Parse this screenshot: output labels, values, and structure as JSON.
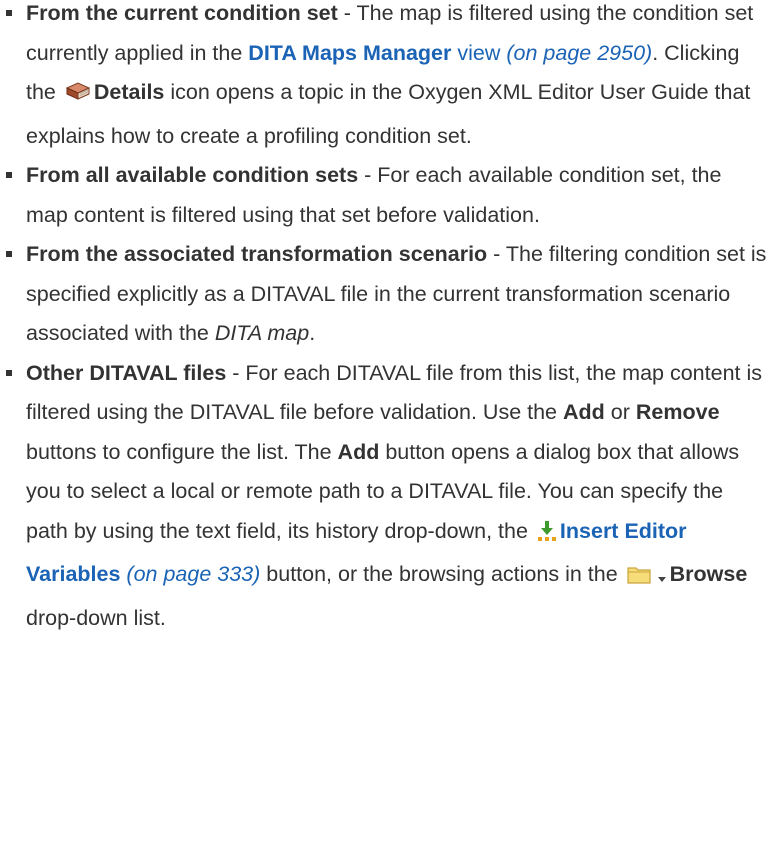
{
  "items": [
    {
      "title": "From the current condition set",
      "sep": " - ",
      "t1": "The map is filtered using the condition set currently applied in the ",
      "link_bold": "DITA Maps Manager",
      "link_tail": " view",
      "pageref": "(on page 2950)",
      "t2": ". Clicking the ",
      "icon": "book-icon",
      "details": "Details",
      "t3": " icon opens a topic in the Oxygen XML Editor User Guide that explains how to create a profiling condition set."
    },
    {
      "title": "From all available condition sets",
      "sep": " - ",
      "t1": "For each available condition set, the map content is filtered using that set before validation."
    },
    {
      "title": "From the associated transformation scenario",
      "sep": " - ",
      "t1": "The filtering condition set is specified explicitly as a DITAVAL file in the current transformation scenario associated with the ",
      "em": "DITA map",
      "t2": "."
    },
    {
      "title": "Other DITAVAL files",
      "sep": " - ",
      "t1": "For each DITAVAL file from this list, the map content is filtered using the DITAVAL file before validation. Use the ",
      "add": "Add",
      "or": " or ",
      "remove": "Remove",
      "t2": " buttons to configure the list. The ",
      "add2": "Add",
      "t3": " button opens a dialog box that allows you to select a local or remote path to a DITAVAL file. You can specify the path by using the text field, its history drop-down, the ",
      "icon1": "insert-variables-icon",
      "link_bold": "Insert Editor Variables",
      "pageref": "(on page 333)",
      "t4": " button, or the browsing actions in the ",
      "icon2": "folder-icon",
      "icon3": "dropdown-arrow-icon",
      "browse": "Browse",
      "t5": " drop-down list."
    }
  ]
}
